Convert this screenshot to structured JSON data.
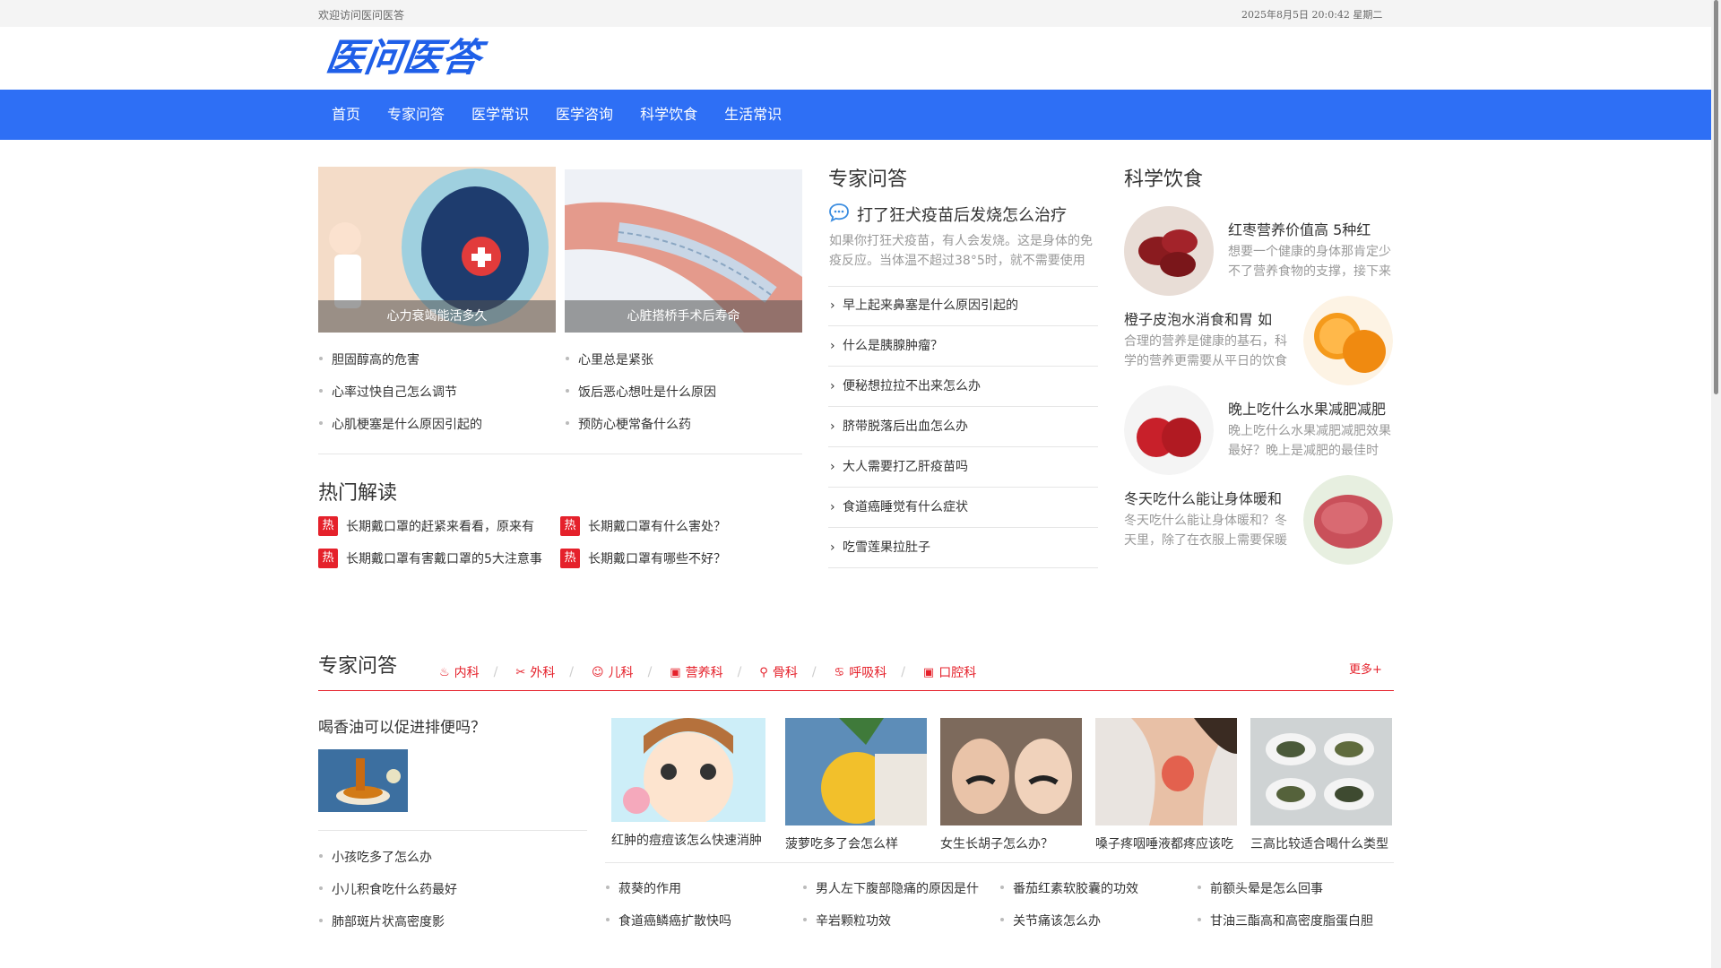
{
  "topbar": {
    "welcome": "欢迎访问医问医答",
    "datetime": "2025年8月5日 20:0:42 星期二"
  },
  "logo": {
    "text": "医问医答"
  },
  "nav": {
    "items": [
      "首页",
      "专家问答",
      "医学常识",
      "医学咨询",
      "科学饮食",
      "生活常识"
    ]
  },
  "features": [
    {
      "caption": "心力衰竭能活多久"
    },
    {
      "caption": "心脏搭桥手术后寿命"
    }
  ],
  "feature_lists": {
    "left": [
      "胆固醇高的危害",
      "心率过快自己怎么调节",
      "心肌梗塞是什么原因引起的"
    ],
    "right": [
      "心里总是紧张",
      "饭后恶心想吐是什么原因",
      "预防心梗常备什么药"
    ]
  },
  "hot": {
    "title": "热门解读",
    "badge": "热",
    "items": [
      "长期戴口罩的赶紧来看看，原来有",
      "长期戴口罩有什么害处？",
      "长期戴口罩有害戴口罩的5大注意事",
      "长期戴口罩有哪些不好？"
    ]
  },
  "expert": {
    "title": "专家问答",
    "first_title": "打了狂犬疫苗后发烧怎么治疗",
    "first_desc": "如果你打狂犬疫苗，有人会发烧。这是身体的免疫反应。当体温不超过38°5时，就不需要使用退",
    "items": [
      "早上起来鼻塞是什么原因引起的",
      "什么是胰腺肿瘤？",
      "便秘想拉拉不出来怎么办",
      "脐带脱落后出血怎么办",
      "大人需要打乙肝疫苗吗",
      "食道癌睡觉有什么症状",
      "吃雪莲果拉肚子"
    ]
  },
  "diet": {
    "title": "科学饮食",
    "items": [
      {
        "title": "红枣营养价值高 5种红",
        "desc": "想要一个健康的身体那肯定少不了营养食物的支撑，接下来"
      },
      {
        "title": "橙子皮泡水消食和胃 如",
        "desc": "合理的营养是健康的基石，科学的营养更需要从平日的饮食"
      },
      {
        "title": "晚上吃什么水果减肥减肥",
        "desc": "晚上吃什么水果减肥减肥效果最好？晚上是减肥的最佳时"
      },
      {
        "title": "冬天吃什么能让身体暖和",
        "desc": "冬天吃什么能让身体暖和？冬天里，除了在衣服上需要保暖"
      }
    ]
  },
  "qa_section": {
    "title": "专家问答",
    "more": "更多+",
    "tabs": [
      "内科",
      "外科",
      "儿科",
      "营养科",
      "骨科",
      "呼吸科",
      "口腔科"
    ],
    "left_title": "喝香油可以促进排便吗？",
    "left_list": [
      "小孩吃多了怎么办",
      "小儿积食吃什么药最好",
      "肺部斑片状高密度影"
    ],
    "cards": [
      "红肿的痘痘该怎么快速消肿",
      "菠萝吃多了会怎么样",
      "女生长胡子怎么办？",
      "嗓子疼咽唾液都疼应该吃",
      "三高比较适合喝什么类型"
    ],
    "bottom_list": [
      "菽葵的作用",
      "男人左下腹部隐痛的原因是什",
      "番茄红素软胶囊的功效",
      "前额头晕是怎么回事",
      "食道癌鳞癌扩散快吗",
      "辛岩颗粒功效",
      "关节痛该怎么办",
      "甘油三酯高和高密度脂蛋白胆"
    ]
  },
  "colors": {
    "nav_bg": "#2e6ff5",
    "accent_red": "#e5212b",
    "logo_blue": "#1f5fe8"
  }
}
